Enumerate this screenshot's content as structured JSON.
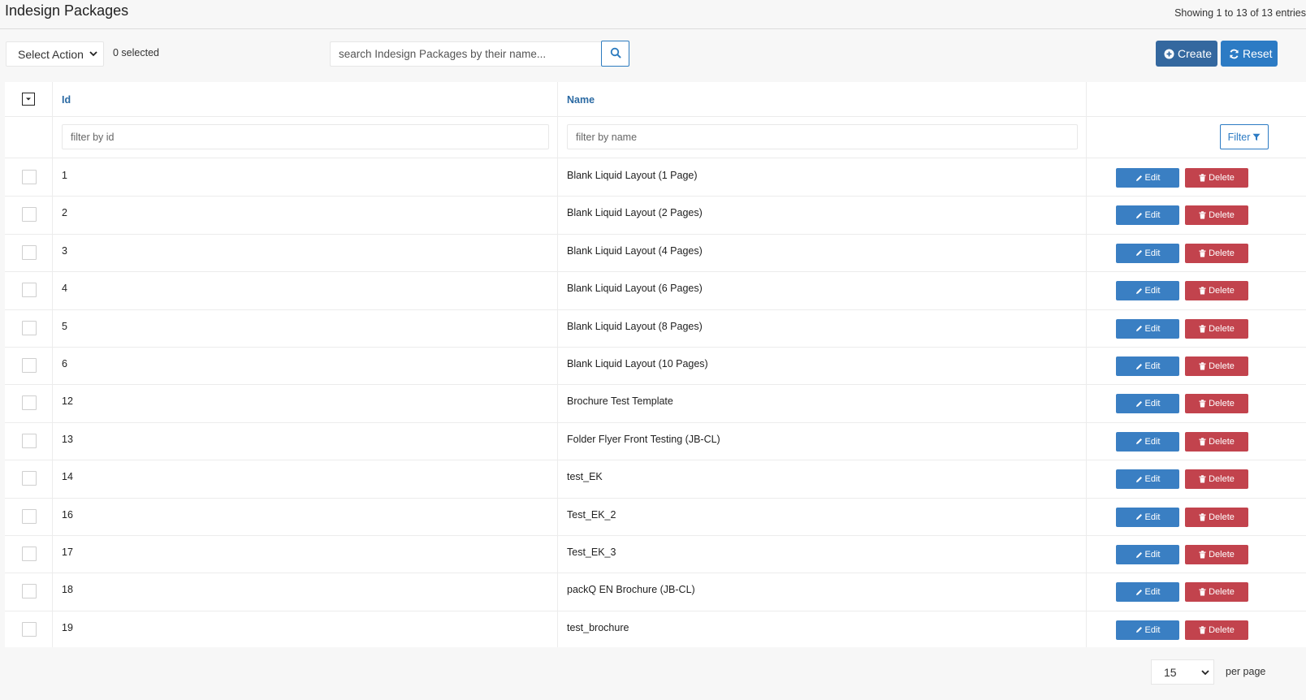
{
  "header": {
    "title": "Indesign Packages",
    "entries_info": "Showing 1 to 13 of 13 entries"
  },
  "toolbar": {
    "select_action_label": "Select Action",
    "selected_count": "0 selected",
    "search_placeholder": "search Indesign Packages by their name...",
    "create_label": "Create",
    "reset_label": "Reset"
  },
  "table": {
    "columns": {
      "id": "Id",
      "name": "Name"
    },
    "filters": {
      "id_placeholder": "filter by id",
      "name_placeholder": "filter by name",
      "filter_button": "Filter"
    },
    "edit_label": "Edit",
    "delete_label": "Delete",
    "rows": [
      {
        "id": "1",
        "name": "Blank Liquid Layout (1 Page)"
      },
      {
        "id": "2",
        "name": "Blank Liquid Layout (2 Pages)"
      },
      {
        "id": "3",
        "name": "Blank Liquid Layout (4 Pages)"
      },
      {
        "id": "4",
        "name": "Blank Liquid Layout (6 Pages)"
      },
      {
        "id": "5",
        "name": "Blank Liquid Layout (8 Pages)"
      },
      {
        "id": "6",
        "name": "Blank Liquid Layout (10 Pages)"
      },
      {
        "id": "12",
        "name": "Brochure Test Template"
      },
      {
        "id": "13",
        "name": "Folder Flyer Front Testing (JB-CL)"
      },
      {
        "id": "14",
        "name": "test_EK"
      },
      {
        "id": "16",
        "name": "Test_EK_2"
      },
      {
        "id": "17",
        "name": "Test_EK_3"
      },
      {
        "id": "18",
        "name": "packQ EN Brochure (JB-CL)"
      },
      {
        "id": "19",
        "name": "test_brochure"
      }
    ]
  },
  "footer": {
    "per_page_value": "15",
    "per_page_label": "per page"
  },
  "colors": {
    "primary": "#34689f",
    "edit": "#3a7fc3",
    "delete": "#c2434d",
    "header_link": "#2b6aa3"
  }
}
